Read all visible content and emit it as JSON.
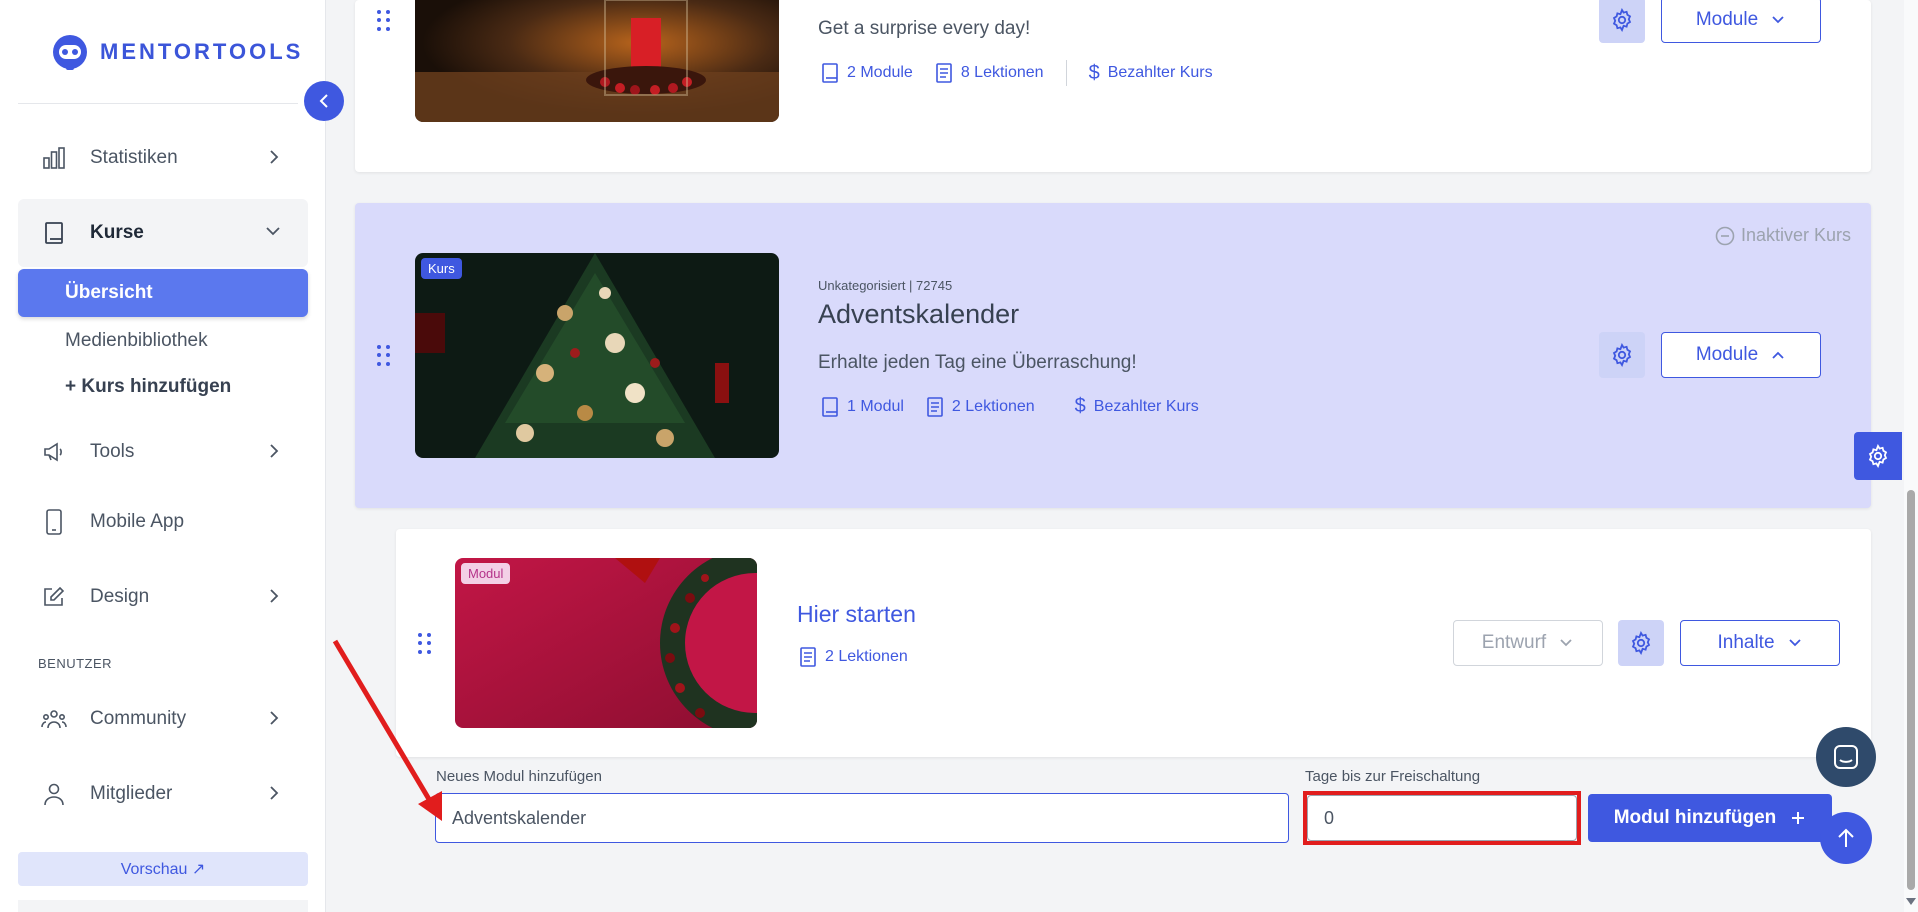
{
  "brand": {
    "name": "MENTORTOOLS"
  },
  "sidebar": {
    "items": [
      {
        "label": "Statistiken",
        "icon": "bar-chart-icon"
      },
      {
        "label": "Kurse",
        "icon": "book-icon"
      },
      {
        "label": "Tools",
        "icon": "megaphone-icon"
      },
      {
        "label": "Mobile App",
        "icon": "mobile-icon"
      },
      {
        "label": "Design",
        "icon": "pencil-icon"
      },
      {
        "label": "Community",
        "icon": "people-icon"
      },
      {
        "label": "Mitglieder",
        "icon": "user-icon"
      }
    ],
    "sub_items": [
      {
        "label": "Übersicht"
      },
      {
        "label": "Medienbibliothek"
      },
      {
        "label": "+ Kurs hinzufügen"
      }
    ],
    "section_label": "BENUTZER",
    "preview_label": "Vorschau ↗"
  },
  "course1": {
    "subtitle": "Get a surprise every day!",
    "modules": "2 Module",
    "lessons": "8 Lektionen",
    "type": "Bezahlter Kurs",
    "module_button": "Module"
  },
  "course2": {
    "badge": "Kurs",
    "status": "Inaktiver Kurs",
    "meta": "Unkategorisiert | 72745",
    "title": "Adventskalender",
    "subtitle": "Erhalte jeden Tag eine Überraschung!",
    "modules": "1 Modul",
    "lessons": "2 Lektionen",
    "type": "Bezahlter Kurs",
    "module_button": "Module"
  },
  "module1": {
    "badge": "Modul",
    "title": "Hier starten",
    "lessons": "2 Lektionen",
    "status_button": "Entwurf",
    "content_button": "Inhalte"
  },
  "add_module": {
    "name_label": "Neues Modul hinzufügen",
    "name_value": "Adventskalender",
    "days_label": "Tage bis zur Freischaltung",
    "days_value": "0",
    "submit_label": "Modul hinzufügen"
  },
  "colors": {
    "accent": "#3f58e0",
    "highlight": "#e11d1d",
    "course_bg": "#d9dafb"
  }
}
